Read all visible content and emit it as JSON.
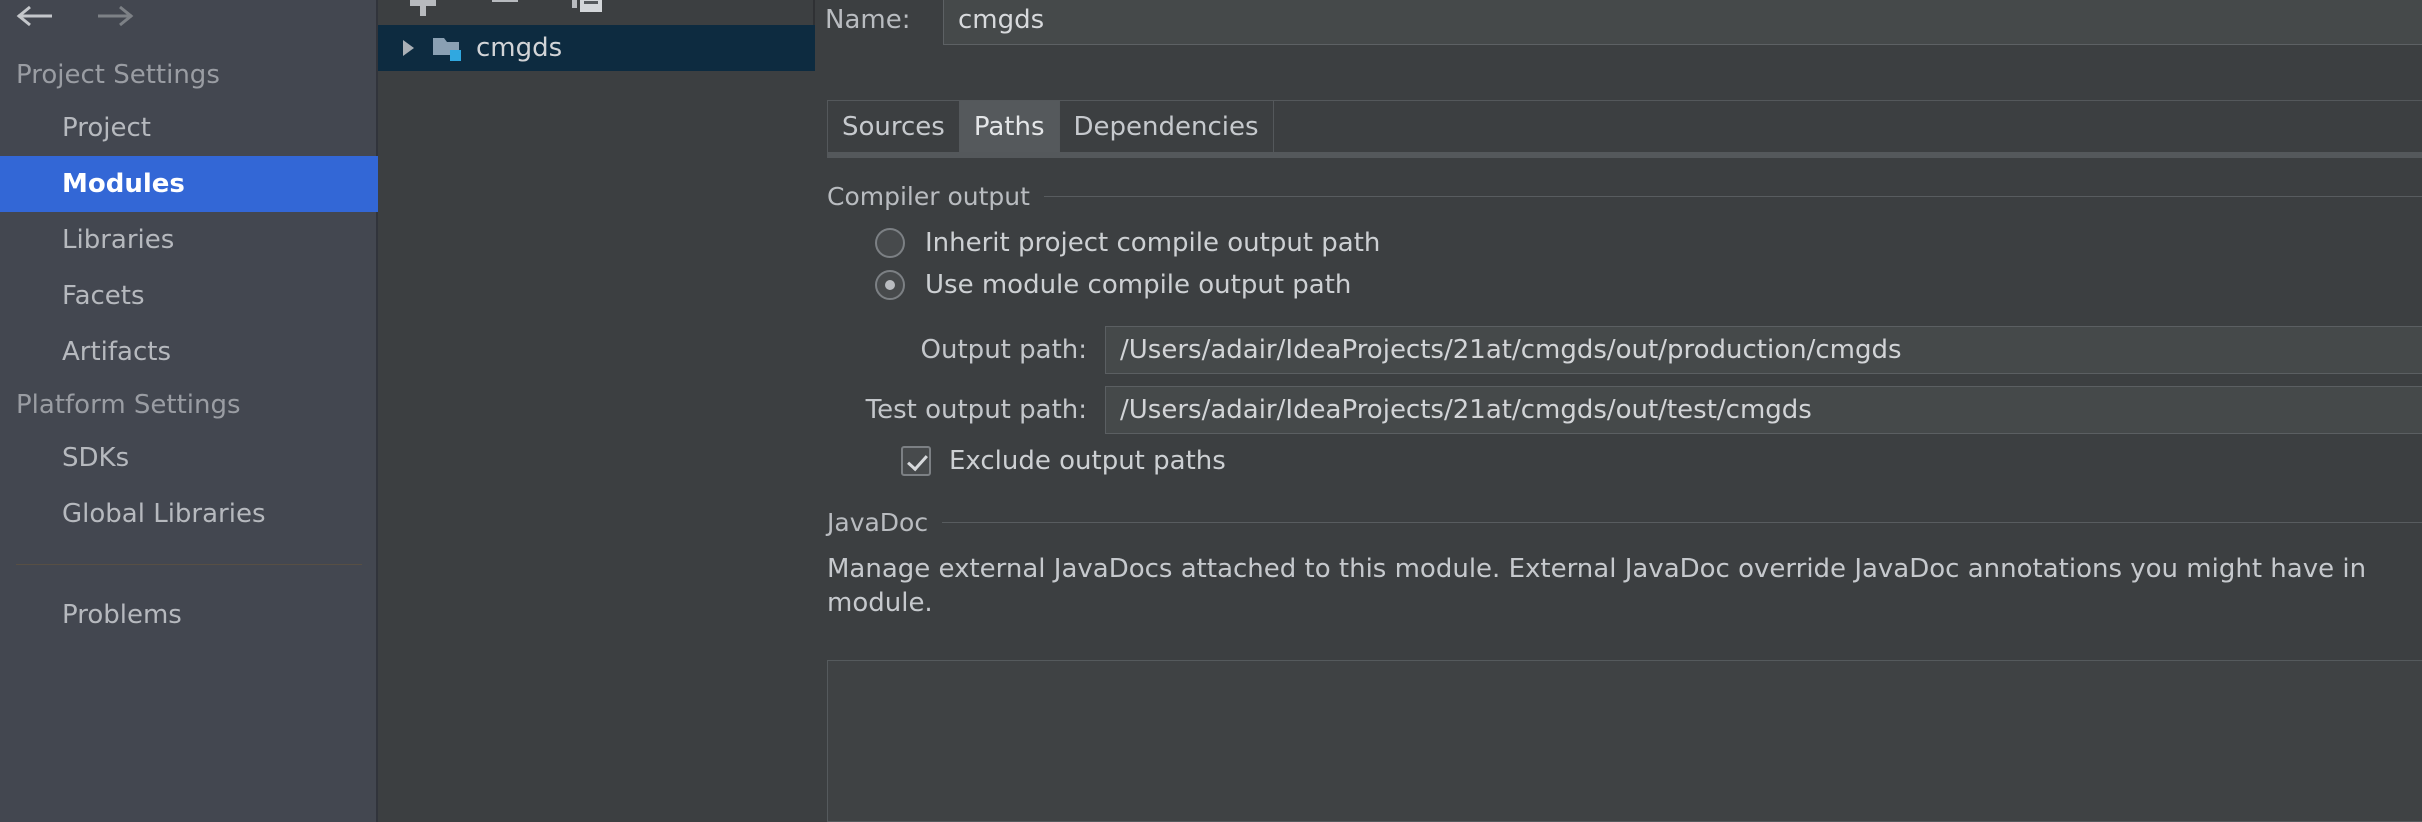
{
  "nav": {
    "back_icon": "arrow-left-icon",
    "forward_icon": "arrow-right-icon"
  },
  "sidebar": {
    "groups": [
      {
        "title": "Project Settings",
        "items": [
          {
            "label": "Project",
            "selected": false
          },
          {
            "label": "Modules",
            "selected": true
          },
          {
            "label": "Libraries",
            "selected": false
          },
          {
            "label": "Facets",
            "selected": false
          },
          {
            "label": "Artifacts",
            "selected": false
          }
        ]
      },
      {
        "title": "Platform Settings",
        "items": [
          {
            "label": "SDKs",
            "selected": false
          },
          {
            "label": "Global Libraries",
            "selected": false
          }
        ]
      }
    ],
    "problems_label": "Problems",
    "selection_color": "#3367d6"
  },
  "tree": {
    "toolbar": [
      {
        "icon": "plus-icon",
        "name": "add-module-button"
      },
      {
        "icon": "minus-icon",
        "name": "remove-module-button"
      },
      {
        "icon": "copy-icon",
        "name": "copy-module-button"
      }
    ],
    "nodes": [
      {
        "label": "cmgds",
        "expand_icon": "triangle-right-icon",
        "node_icon": "module-folder-icon",
        "selected": true,
        "selection_color": "#0d2b40"
      }
    ]
  },
  "detail": {
    "name_label": "Name:",
    "name_value": "cmgds",
    "name_placeholder": "",
    "tabs": [
      {
        "label": "Sources",
        "active": false
      },
      {
        "label": "Paths",
        "active": true
      },
      {
        "label": "Dependencies",
        "active": false
      }
    ],
    "compiler_output": {
      "section_title": "Compiler output",
      "radios": [
        {
          "label": "Inherit project compile output path",
          "checked": false
        },
        {
          "label": "Use module compile output path",
          "checked": true
        }
      ],
      "fields": [
        {
          "label": "Output path:",
          "value": "/Users/adair/IdeaProjects/21at/cmgds/out/production/cmgds",
          "placeholder": ""
        },
        {
          "label": "Test output path:",
          "value": "/Users/adair/IdeaProjects/21at/cmgds/out/test/cmgds",
          "placeholder": ""
        }
      ],
      "checkbox": {
        "label": "Exclude output paths",
        "checked": true
      }
    },
    "javadoc": {
      "section_title": "JavaDoc",
      "description": "Manage external JavaDocs attached to this module. External JavaDoc override JavaDoc annotations you might have in\nmodule."
    }
  }
}
